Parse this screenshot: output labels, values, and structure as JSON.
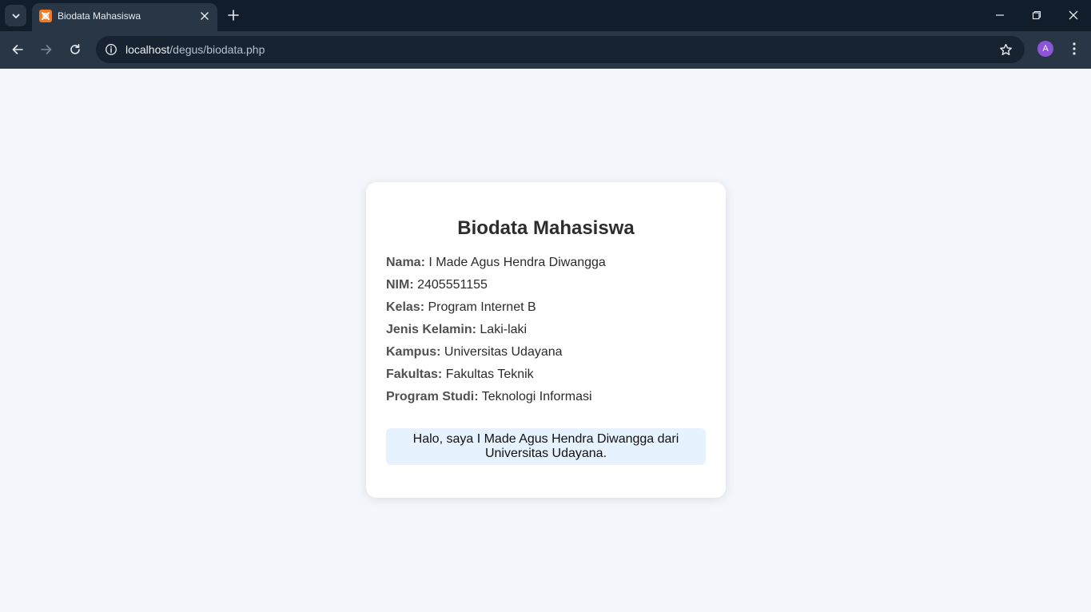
{
  "browser": {
    "tab_title": "Biodata Mahasiswa",
    "url_host": "localhost",
    "url_path": "/degus/biodata.php",
    "profile_initial": "A",
    "favicon_color": "#f37a21",
    "avatar_color": "#8a55d8"
  },
  "page": {
    "title": "Biodata Mahasiswa",
    "fields": [
      {
        "label": "Nama:",
        "value": "I Made Agus Hendra Diwangga"
      },
      {
        "label": "NIM:",
        "value": "2405551155"
      },
      {
        "label": "Kelas:",
        "value": "Program Internet B"
      },
      {
        "label": "Jenis Kelamin:",
        "value": "Laki-laki"
      },
      {
        "label": "Kampus:",
        "value": "Universitas Udayana"
      },
      {
        "label": "Fakultas:",
        "value": "Fakultas Teknik"
      },
      {
        "label": "Program Studi:",
        "value": "Teknologi Informasi"
      }
    ],
    "greeting": "Halo, saya I Made Agus Hendra Diwangga dari Universitas Udayana."
  }
}
